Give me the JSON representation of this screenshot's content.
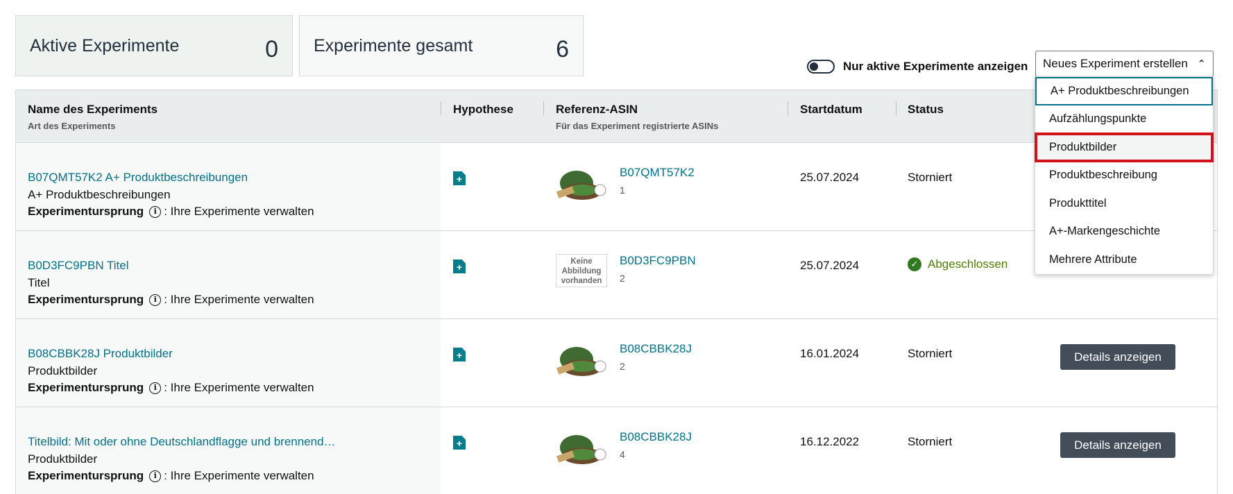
{
  "stats": {
    "active_label": "Aktive Experimente",
    "active_value": "0",
    "total_label": "Experimente gesamt",
    "total_value": "6"
  },
  "toggle": {
    "label": "Nur aktive Experimente anzeigen",
    "on": false
  },
  "create_dropdown": {
    "label": "Neues Experiment erstellen",
    "options": [
      "A+ Produktbeschreibungen",
      "Aufzählungspunkte",
      "Produktbilder",
      "Produktbeschreibung",
      "Produkttitel",
      "A+-Markengeschichte",
      "Mehrere Attribute"
    ],
    "highlighted": "Produktbilder"
  },
  "table": {
    "headers": {
      "name": "Name des Experiments",
      "name_sub": "Art des Experiments",
      "hypothesis": "Hypothese",
      "asin": "Referenz-ASIN",
      "asin_sub": "Für das Experiment registrierte ASINs",
      "start": "Startdatum",
      "status": "Status"
    },
    "origin_label": "Experimentursprung",
    "origin_value": ": Ihre Experimente verwalten",
    "rows": [
      {
        "name": "B07QMT57K2 A+ Produktbeschreibungen",
        "type": "A+ Produktbeschreibungen",
        "asin": "B07QMT57K2",
        "asin_count": "1",
        "date": "25.07.2024",
        "status": "Storniert",
        "has_image": true
      },
      {
        "name": "B0D3FC9PBN Titel",
        "type": "Titel",
        "asin": "B0D3FC9PBN",
        "asin_count": "2",
        "date": "25.07.2024",
        "status": "Abgeschlossen",
        "has_image": false,
        "no_image_text": "Keine Abbildung vorhanden"
      },
      {
        "name": "B08CBBK28J Produktbilder",
        "type": "Produktbilder",
        "asin": "B08CBBK28J",
        "asin_count": "2",
        "date": "16.01.2024",
        "status": "Storniert",
        "has_image": true,
        "button": "Details anzeigen"
      },
      {
        "name": "Titelbild: Mit oder ohne Deutschlandflagge und brennend…",
        "type": "Produktbilder",
        "asin": "B08CBBK28J",
        "asin_count": "4",
        "date": "16.12.2022",
        "status": "Storniert",
        "has_image": true,
        "button": "Details anzeigen"
      }
    ]
  },
  "icons": {
    "hypothesis": "document-plus-icon",
    "info": "info-circle-icon",
    "status_done": "check-circle-icon",
    "dropdown": "chevron-up-icon"
  },
  "colors": {
    "link": "#007185",
    "button": "#434d59",
    "highlight_border": "#d1121b",
    "success": "#4c7d03"
  }
}
